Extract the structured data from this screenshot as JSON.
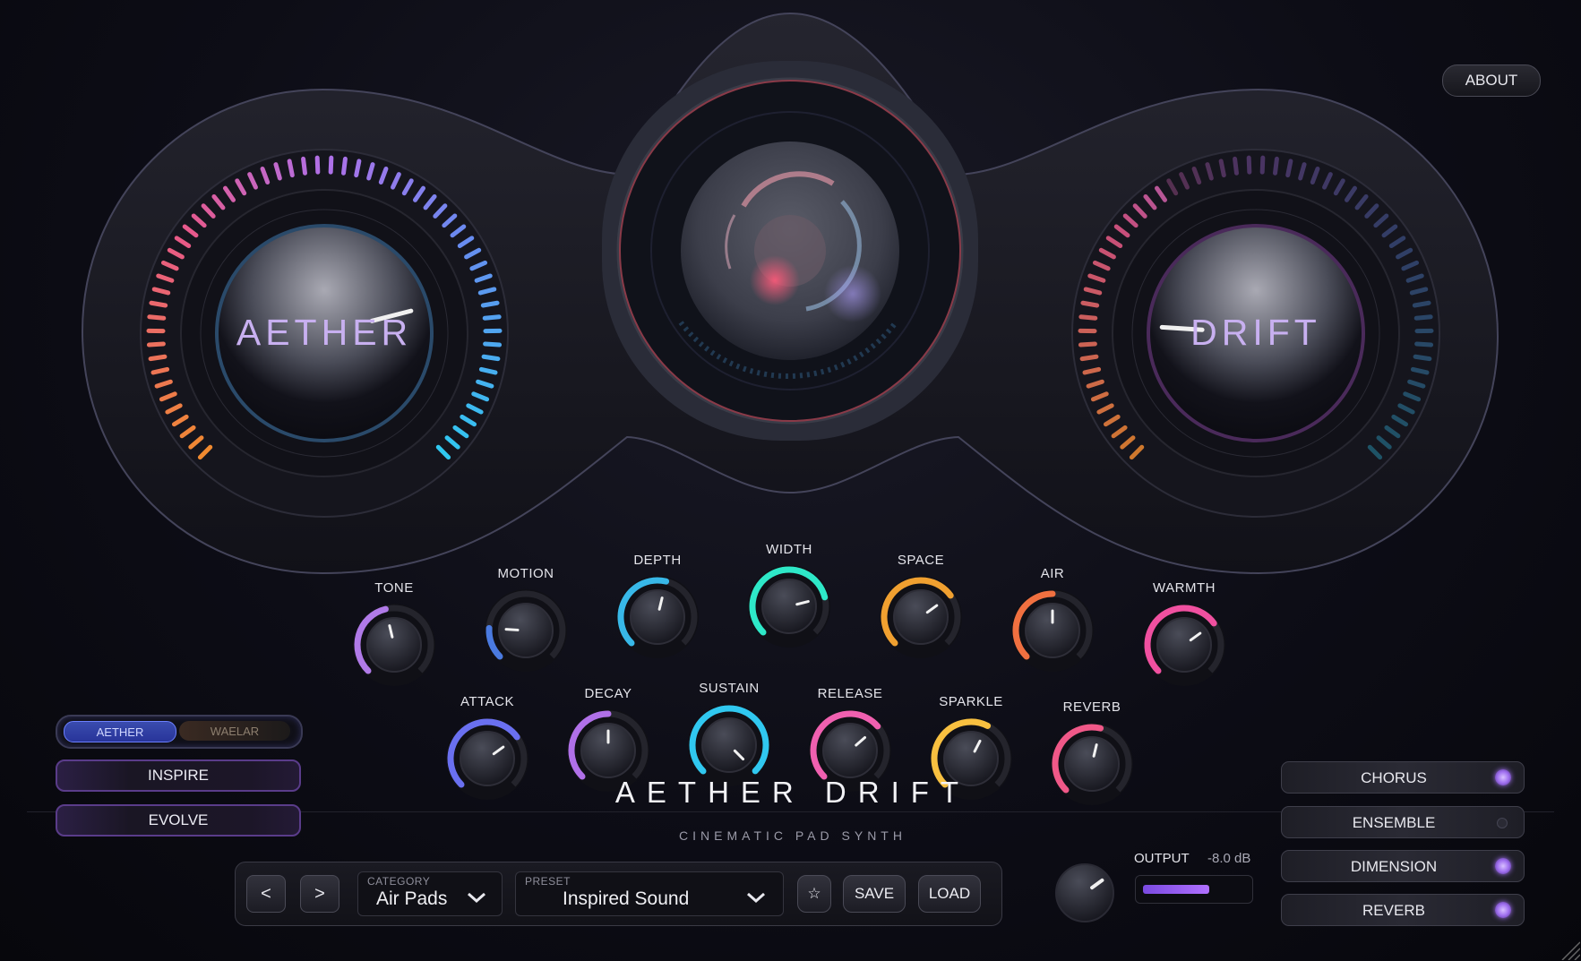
{
  "app": {
    "title": "AETHER DRIFT",
    "subtitle": "CINEMATIC PAD SYNTH",
    "about_label": "ABOUT"
  },
  "macros": {
    "left": {
      "label": "AETHER",
      "value": 0.78
    },
    "right": {
      "label": "DRIFT",
      "value": 0.18
    }
  },
  "knobs_row1": [
    {
      "label": "TONE",
      "value": 0.45,
      "color": "#b07ae8"
    },
    {
      "label": "MOTION",
      "value": 0.18,
      "color": "#4a7ae0"
    },
    {
      "label": "DEPTH",
      "value": 0.55,
      "color": "#38b8e8"
    },
    {
      "label": "WIDTH",
      "value": 0.78,
      "color": "#2ee8c8"
    },
    {
      "label": "SPACE",
      "value": 0.7,
      "color": "#f0a030"
    },
    {
      "label": "AIR",
      "value": 0.5,
      "color": "#f07040"
    },
    {
      "label": "WARMTH",
      "value": 0.7,
      "color": "#f050a0"
    }
  ],
  "knobs_row2": [
    {
      "label": "ATTACK",
      "value": 0.7,
      "color": "#6a70f0"
    },
    {
      "label": "DECAY",
      "value": 0.5,
      "color": "#b070e8"
    },
    {
      "label": "SUSTAIN",
      "value": 1.0,
      "color": "#30c8f0"
    },
    {
      "label": "RELEASE",
      "value": 0.68,
      "color": "#f060b0"
    },
    {
      "label": "SPARKLE",
      "value": 0.6,
      "color": "#f8c040"
    },
    {
      "label": "REVERB",
      "value": 0.55,
      "color": "#f05888"
    }
  ],
  "mode_toggle": {
    "active": "AETHER",
    "inactive": "WAELAR"
  },
  "side_buttons": {
    "inspire": "INSPIRE",
    "evolve": "EVOLVE"
  },
  "preset_bar": {
    "prev": "<",
    "next": ">",
    "category_caption": "CATEGORY",
    "category_value": "Air Pads",
    "preset_caption": "PRESET",
    "preset_value": "Inspired Sound",
    "favorite": "☆",
    "save": "SAVE",
    "load": "LOAD"
  },
  "output": {
    "label": "OUTPUT",
    "db": "-8.0 dB",
    "knob_value": 0.7,
    "meter_level": 0.65
  },
  "fx": [
    {
      "label": "CHORUS",
      "on": true
    },
    {
      "label": "ENSEMBLE",
      "on": false
    },
    {
      "label": "DIMENSION",
      "on": true
    },
    {
      "label": "REVERB",
      "on": true
    }
  ],
  "colors": {
    "accent_purple": "#a070f0",
    "macro_label": "#c8b0f0"
  }
}
